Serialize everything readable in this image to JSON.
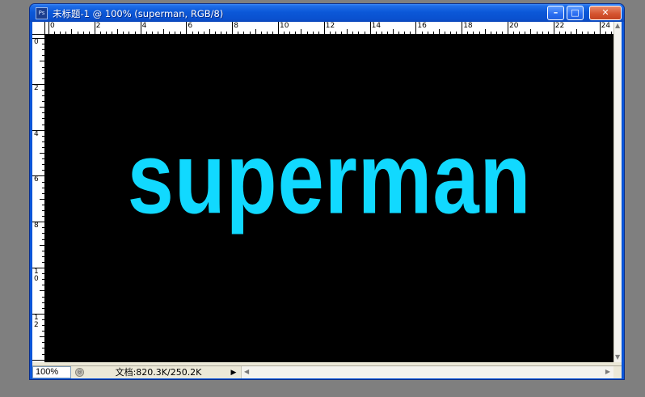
{
  "window": {
    "title": "未标题-1 @ 100% (superman, RGB/8)",
    "app_icon_label": "Ps",
    "buttons": {
      "minimize": "–",
      "maximize": "□",
      "close": "✕"
    }
  },
  "ruler": {
    "horizontal_labels": [
      "0",
      "2",
      "4",
      "6",
      "8",
      "10",
      "12",
      "14",
      "16",
      "18",
      "20",
      "22",
      "24"
    ],
    "vertical_labels": [
      "0",
      "2",
      "4",
      "6",
      "8",
      "10",
      "12"
    ]
  },
  "canvas": {
    "text": "superman",
    "text_color": "#11d9ff",
    "background": "#000000"
  },
  "status": {
    "zoom": "100%",
    "doc_info": "文档:820.3K/250.2K",
    "menu_arrow": "▶"
  },
  "colors": {
    "titlebar": "#0a55d8",
    "chrome": "#ece9d8",
    "desktop": "#7f7f7f"
  }
}
